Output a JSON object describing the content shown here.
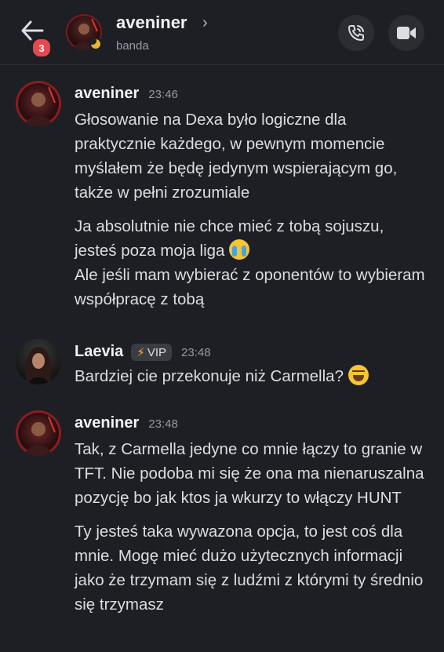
{
  "header": {
    "unread_count": "3",
    "title": "aveniner",
    "chevron": "›",
    "subtitle": "banda",
    "icons": {
      "back": "arrow-left-icon",
      "call": "phone-call-icon",
      "video": "video-camera-icon",
      "status": "idle-moon-icon"
    }
  },
  "messages": [
    {
      "author": "aveniner",
      "time": "23:46",
      "paragraphs": [
        "Głosowanie na Dexa było logiczne dla praktycznie każdego, w pewnym momencie myślałem że będę jedynym wspierającym go, także w pełni zrozumiale",
        "Ja absolutnie nie chce mieć z tobą sojuszu, jesteś poza moja liga",
        "Ale jeśli mam wybierać z oponentów to wybieram współpracę z tobą"
      ],
      "emoji": "loudly-crying-emoji"
    },
    {
      "author": "Laevia",
      "badge": "VIP",
      "time": "23:48",
      "paragraphs": [
        "Bardziej cie przekonuje niż Carmella?"
      ],
      "emoji": "grinning-squinting-emoji"
    },
    {
      "author": "aveniner",
      "time": "23:48",
      "paragraphs": [
        "Tak, z Carmella jedyne co mnie łączy to granie w TFT. Nie podoba mi się że ona ma nienaruszalna pozycję bo jak ktos ja wkurzy to włączy HUNT",
        "Ty jesteś taka wywazona opcja, to jest coś dla mnie. Mogę mieć dużo użytecznych informacji jako że trzymam się z ludźmi z którymi ty średnio się trzymasz"
      ]
    }
  ],
  "colors": {
    "background": "#1e1f24",
    "badge": "#e5484d",
    "status_idle": "#f0b232",
    "text": "#dbdee1",
    "muted": "#949ba4"
  }
}
